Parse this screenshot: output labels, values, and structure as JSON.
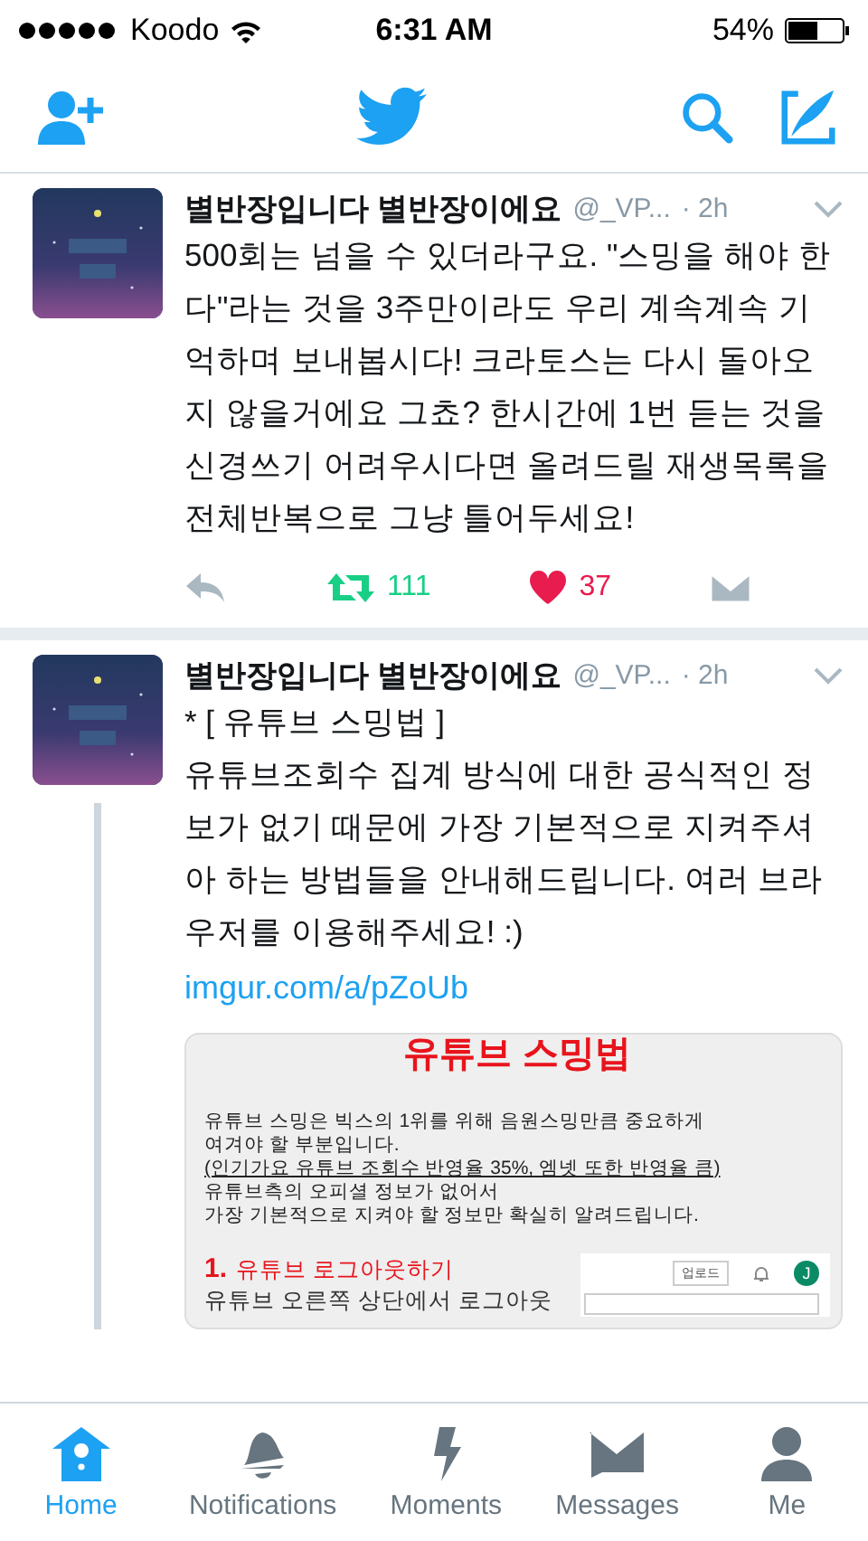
{
  "status_bar": {
    "carrier": "Koodo",
    "time": "6:31 AM",
    "battery": "54%"
  },
  "tweets": [
    {
      "name": "별반장입니다 별반장이에요",
      "handle": "@_VP...",
      "time": "· 2h",
      "lines": [
        "500회는 넘을 수 있더라구요. \"스밍을 해야 한다\"라는 것을 3주만이라도 우리 계속계속 기억하며 보내봅시다! 크라토스는 다시 돌아오지 않을거에요 그쵸? 한시간에 1번 듣는 것을 신경쓰기 어려우시다면 올려드릴 재생목록을 전체반복으로 그냥 틀어두세요!"
      ],
      "thread": false,
      "actions": {
        "retweets": "111",
        "retweeted": true,
        "likes": "37",
        "liked": true
      }
    },
    {
      "name": "별반장입니다 별반장이에요",
      "handle": "@_VP...",
      "time": "· 2h",
      "lines": [
        "* [ 유튜브 스밍법 ]",
        "유튜브조회수 집계 방식에 대한 공식적인 정보가 없기 때문에 가장 기본적으로 지켜주셔아 하는 방법들을 안내해드립니다. 여러 브라우저를 이용해주세요! :)"
      ],
      "link": "imgur.com/a/pZoUb",
      "thread": true,
      "image": {
        "title": "유튜브 스밍법",
        "paragraphs": [
          {
            "lines": [
              "유튜브 스밍은 빅스의 1위를 위해 음원스밍만큼 중요하게",
              "여겨야 할 부분입니다."
            ],
            "underline": false
          },
          {
            "lines": [
              "(인기가요 유튜브 조회수 반영율 35%, 엠넷 또한 반영율 큼)"
            ],
            "underline": true
          },
          {
            "lines": [
              "유튜브측의 오피셜 정보가 없어서",
              "가장 기본적으로 지켜야 할 정보만 확실히 알려드립니다."
            ],
            "underline": false
          }
        ],
        "step_number": "1.",
        "step_title": "유튜브 로그아웃하기",
        "step_text": "유튜브 오른쪽 상단에서 로그아웃",
        "mini_button": "업로드",
        "mini_avatar": "J"
      }
    }
  ],
  "tabs": [
    {
      "label": "Home",
      "selected": true
    },
    {
      "label": "Notifications",
      "selected": false
    },
    {
      "label": "Moments",
      "selected": false
    },
    {
      "label": "Messages",
      "selected": false
    },
    {
      "label": "Me",
      "selected": false
    }
  ]
}
